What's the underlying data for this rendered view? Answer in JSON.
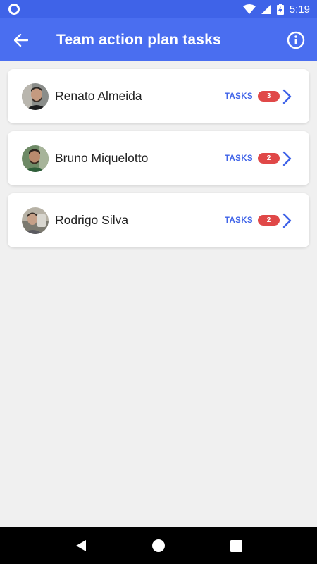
{
  "status_bar": {
    "time": "5:19",
    "icons": [
      "circle-notification-icon",
      "wifi-icon",
      "signal-icon",
      "battery-charging-icon"
    ]
  },
  "app_bar": {
    "title": "Team action plan tasks",
    "back_icon": "arrow-left-icon",
    "info_icon": "info-icon"
  },
  "team": {
    "members": [
      {
        "name": "Renato Almeida",
        "tasks_label": "TASKS",
        "count": "3"
      },
      {
        "name": "Bruno Miquelotto",
        "tasks_label": "TASKS",
        "count": "2"
      },
      {
        "name": "Rodrigo Silva",
        "tasks_label": "TASKS",
        "count": "2"
      }
    ]
  },
  "nav_bar": {
    "icons": [
      "back-triangle-icon",
      "home-circle-icon",
      "recents-square-icon"
    ]
  },
  "colors": {
    "primary": "#4a6ef0",
    "status_bar": "#3f63e8",
    "badge": "#e04848",
    "background": "#f0f0f0"
  }
}
